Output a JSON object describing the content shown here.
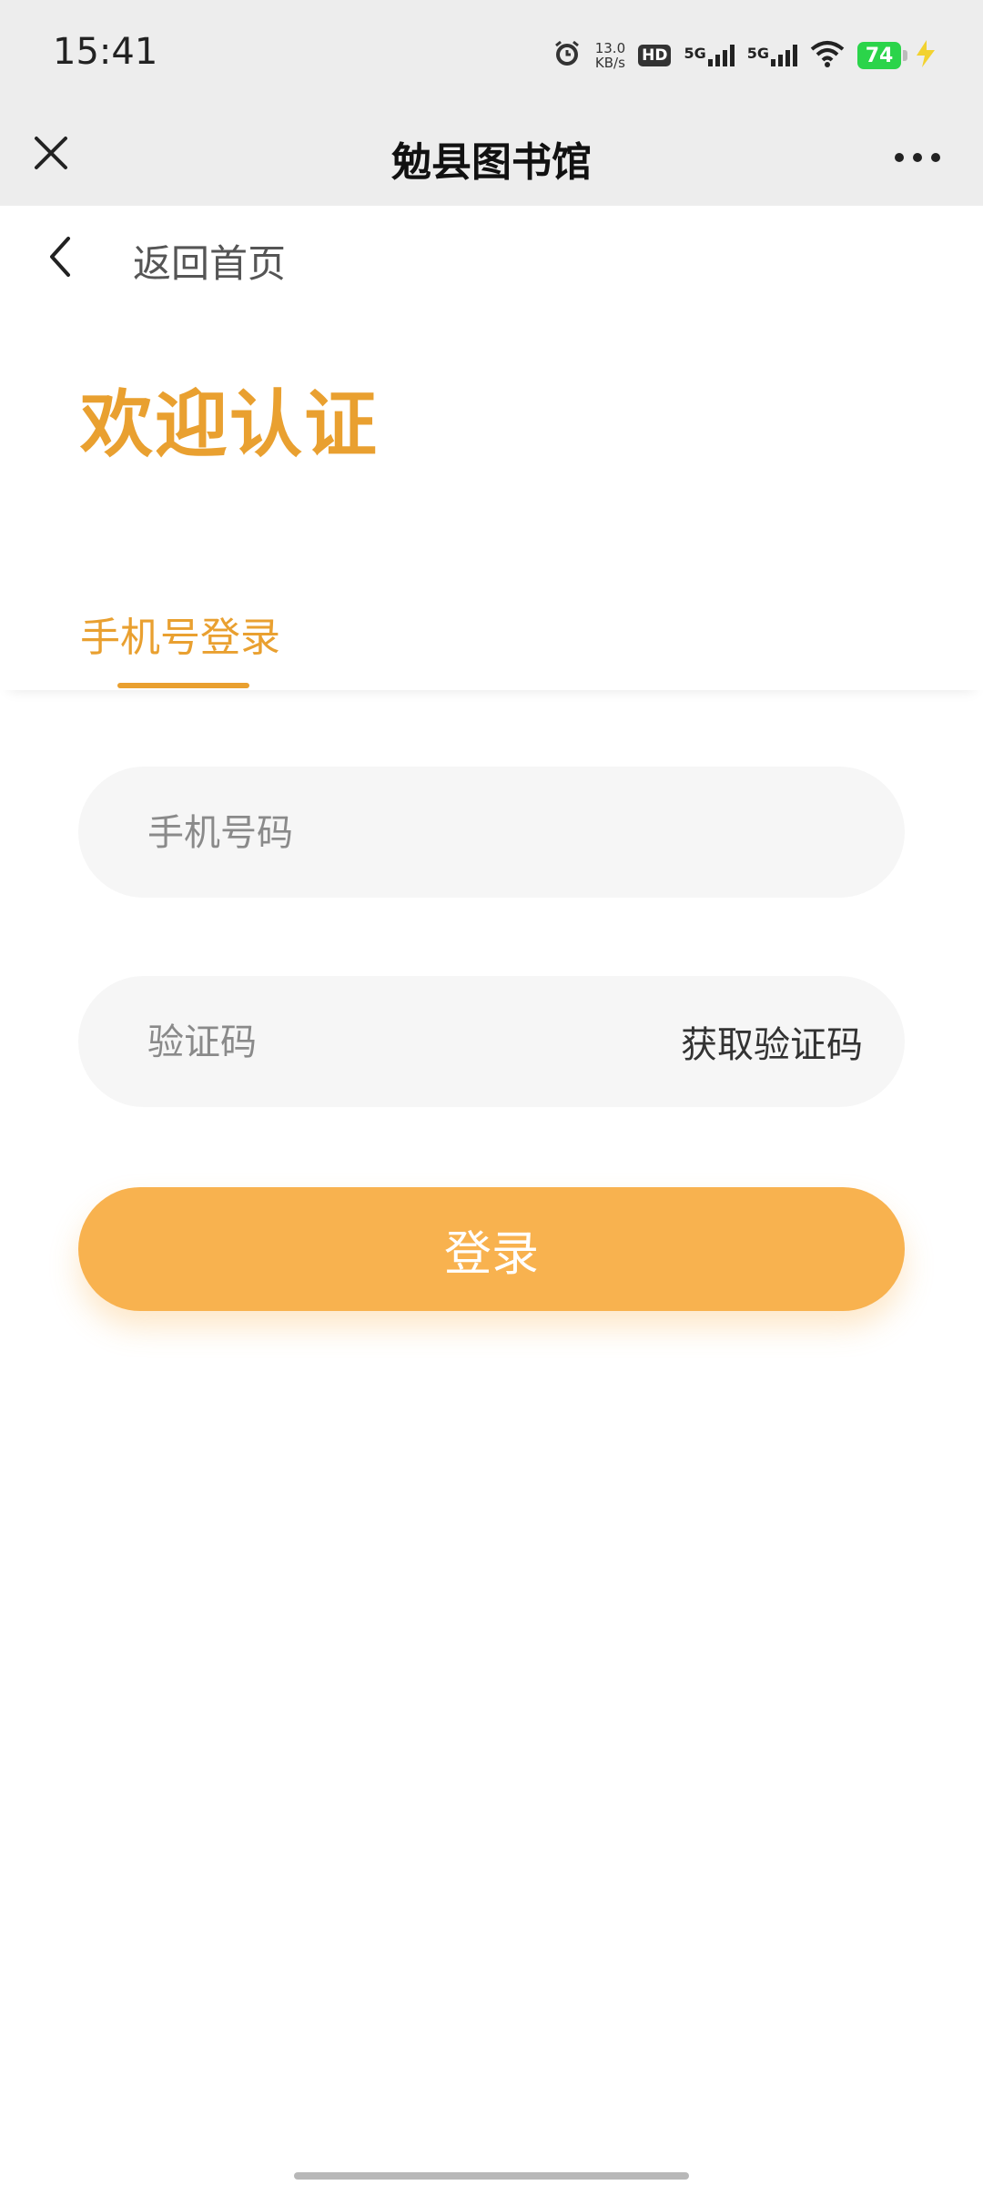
{
  "status_bar": {
    "time": "15:41",
    "net_speed_value": "13.0",
    "net_speed_unit": "KB/s",
    "hd_label": "HD",
    "sim1_label": "5G",
    "sim2_label": "5G",
    "battery_level": "74",
    "icons": [
      "alarm-icon",
      "hd-icon",
      "signal-icon",
      "signal-icon",
      "wifi-icon",
      "battery-icon",
      "charging-icon"
    ]
  },
  "title_bar": {
    "title": "勉县图书馆",
    "close_icon": "close-icon",
    "more_icon": "more-icon"
  },
  "back": {
    "label": "返回首页",
    "icon": "chevron-left-icon"
  },
  "welcome": {
    "title": "欢迎认证"
  },
  "tabs": [
    {
      "label": "手机号登录",
      "active": true
    }
  ],
  "form": {
    "phone_placeholder": "手机号码",
    "code_placeholder": "验证码",
    "get_code_label": "获取验证码",
    "login_label": "登录"
  },
  "colors": {
    "accent": "#e9a030",
    "button": "#f8b24f",
    "field_bg": "#f6f6f6",
    "header_bg": "#ededed"
  }
}
